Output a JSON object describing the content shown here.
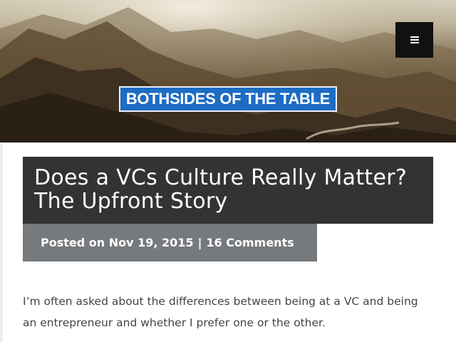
{
  "header": {
    "logo_text": "BOTHSIDES OF THE TABLE",
    "menu_icon": "hamburger-icon"
  },
  "post": {
    "title": "Does a VCs Culture Really Matter? The Upfront Story",
    "posted_label": "Posted on",
    "date": "Nov 19, 2015",
    "separator": "|",
    "comments": "16 Comments",
    "intro": "I’m often asked about the differences between being at a VC and being an entrepreneur and whether I prefer one or the other."
  },
  "colors": {
    "logo_bg": "#1d6cc4",
    "title_bg": "#333333",
    "meta_bg": "#777a7d",
    "menu_bg": "#111111"
  }
}
